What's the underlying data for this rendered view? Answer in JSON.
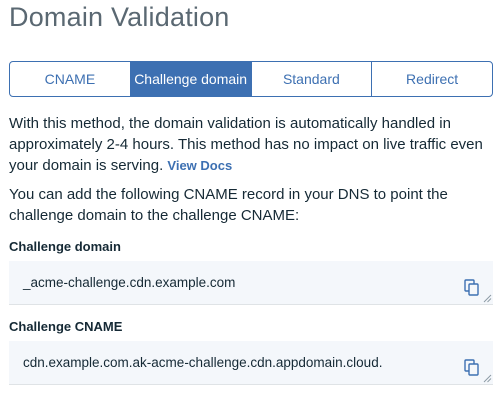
{
  "page": {
    "title": "Domain Validation"
  },
  "tabs": [
    {
      "label": "CNAME",
      "active": false
    },
    {
      "label": "Challenge domain",
      "active": true
    },
    {
      "label": "Standard",
      "active": false
    },
    {
      "label": "Redirect",
      "active": false
    }
  ],
  "description": {
    "text": "With this method, the domain validation is automatically handled in approximately 2-4 hours. This method has no impact on live traffic even your domain is serving. ",
    "link_label": "View Docs"
  },
  "instruction": "You can add the following CNAME record in your DNS to point the challenge domain to the challenge CNAME:",
  "fields": {
    "challenge_domain": {
      "label": "Challenge domain",
      "value": "_acme-challenge.cdn.example.com"
    },
    "challenge_cname": {
      "label": "Challenge CNAME",
      "value": "cdn.example.com.ak-acme-challenge.cdn.appdomain.cloud."
    }
  },
  "icons": {
    "copy": "copy-icon",
    "resize": "resize-grip-icon"
  },
  "colors": {
    "accent": "#3d70b2",
    "title": "#5a6872",
    "field_bg": "#f4f7fb"
  }
}
